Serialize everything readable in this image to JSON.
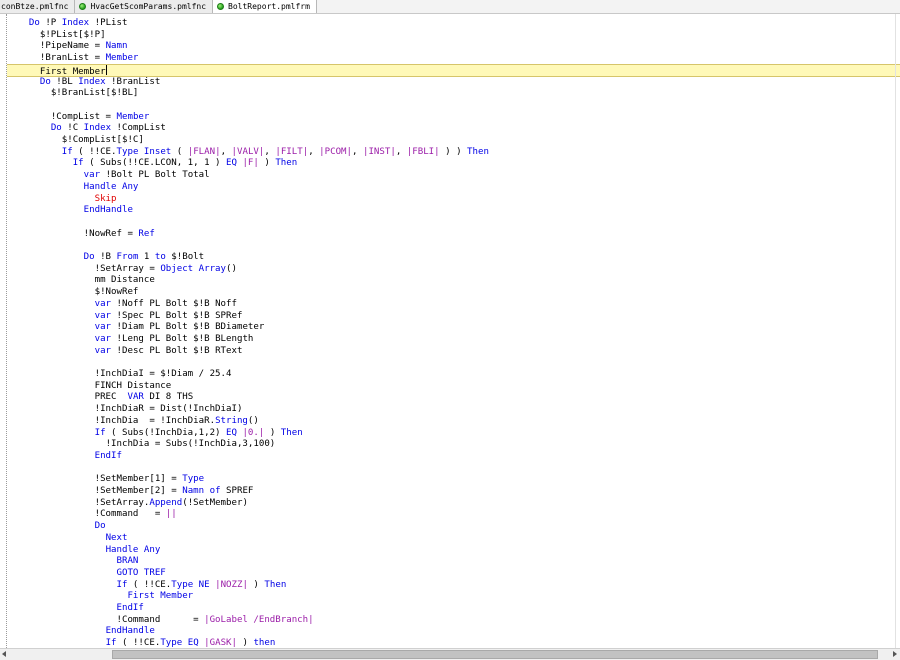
{
  "tabs": [
    {
      "label": "conBtze.pmlfnc",
      "icon": "none",
      "active": false
    },
    {
      "label": "HvacGetScomParams.pmlfnc",
      "icon": "pml-file-icon",
      "active": false
    },
    {
      "label": "BoltReport.pmlfrm",
      "icon": "pml-file-icon",
      "active": true
    }
  ],
  "colors": {
    "keyword": "#0000e6",
    "string": "#9b1da8",
    "red": "#e00000",
    "current_line": "#fff9b8"
  },
  "editor": {
    "current_line_index": 4,
    "lines": [
      {
        "indent": 4,
        "tokens": [
          {
            "t": "Do",
            "k": "kw"
          },
          {
            "t": " !P "
          },
          {
            "t": "Index",
            "k": "kw"
          },
          {
            "t": " !PList"
          }
        ]
      },
      {
        "indent": 6,
        "tokens": [
          {
            "t": "$!PList[$!P]"
          }
        ]
      },
      {
        "indent": 6,
        "tokens": [
          {
            "t": "!PipeName = "
          },
          {
            "t": "Namn",
            "k": "kw"
          }
        ]
      },
      {
        "indent": 6,
        "tokens": [
          {
            "t": "!BranList = "
          },
          {
            "t": "Member",
            "k": "kw"
          }
        ]
      },
      {
        "indent": 6,
        "tokens": [
          {
            "t": "First Member"
          }
        ]
      },
      {
        "indent": 6,
        "tokens": [
          {
            "t": "Do",
            "k": "kw"
          },
          {
            "t": " !BL "
          },
          {
            "t": "Index",
            "k": "kw"
          },
          {
            "t": " !BranList"
          }
        ]
      },
      {
        "indent": 8,
        "tokens": [
          {
            "t": "$!BranList[$!BL]"
          }
        ]
      },
      {
        "indent": 0,
        "tokens": []
      },
      {
        "indent": 8,
        "tokens": [
          {
            "t": "!CompList = "
          },
          {
            "t": "Member",
            "k": "kw"
          }
        ]
      },
      {
        "indent": 8,
        "tokens": [
          {
            "t": "Do",
            "k": "kw"
          },
          {
            "t": " !C "
          },
          {
            "t": "Index",
            "k": "kw"
          },
          {
            "t": " !CompList"
          }
        ]
      },
      {
        "indent": 10,
        "tokens": [
          {
            "t": "$!CompList[$!C]"
          }
        ]
      },
      {
        "indent": 10,
        "tokens": [
          {
            "t": "If",
            "k": "kw"
          },
          {
            "t": " ( !!CE."
          },
          {
            "t": "Type",
            "k": "kw"
          },
          {
            "t": " "
          },
          {
            "t": "Inset",
            "k": "kw"
          },
          {
            "t": " ( "
          },
          {
            "t": "|FLAN|",
            "k": "str"
          },
          {
            "t": ", "
          },
          {
            "t": "|VALV|",
            "k": "str"
          },
          {
            "t": ", "
          },
          {
            "t": "|FILT|",
            "k": "str"
          },
          {
            "t": ", "
          },
          {
            "t": "|PCOM|",
            "k": "str"
          },
          {
            "t": ", "
          },
          {
            "t": "|INST|",
            "k": "str"
          },
          {
            "t": ", "
          },
          {
            "t": "|FBLI|",
            "k": "str"
          },
          {
            "t": " ) ) "
          },
          {
            "t": "Then",
            "k": "kw"
          }
        ]
      },
      {
        "indent": 12,
        "tokens": [
          {
            "t": "If",
            "k": "kw"
          },
          {
            "t": " ( Subs(!!CE.LCON, 1, 1 ) "
          },
          {
            "t": "EQ",
            "k": "kw"
          },
          {
            "t": " "
          },
          {
            "t": "|F|",
            "k": "str"
          },
          {
            "t": " ) "
          },
          {
            "t": "Then",
            "k": "kw"
          }
        ]
      },
      {
        "indent": 14,
        "tokens": [
          {
            "t": "var",
            "k": "kw"
          },
          {
            "t": " !Bolt PL Bolt Total"
          }
        ]
      },
      {
        "indent": 14,
        "tokens": [
          {
            "t": "Handle Any",
            "k": "kw"
          }
        ]
      },
      {
        "indent": 16,
        "tokens": [
          {
            "t": "Skip",
            "k": "red"
          }
        ]
      },
      {
        "indent": 14,
        "tokens": [
          {
            "t": "EndHandle",
            "k": "kw"
          }
        ]
      },
      {
        "indent": 0,
        "tokens": []
      },
      {
        "indent": 14,
        "tokens": [
          {
            "t": "!NowRef = "
          },
          {
            "t": "Ref",
            "k": "kw"
          }
        ]
      },
      {
        "indent": 0,
        "tokens": []
      },
      {
        "indent": 14,
        "tokens": [
          {
            "t": "Do",
            "k": "kw"
          },
          {
            "t": " !B "
          },
          {
            "t": "From",
            "k": "kw"
          },
          {
            "t": " 1 "
          },
          {
            "t": "to",
            "k": "kw"
          },
          {
            "t": " $!Bolt"
          }
        ]
      },
      {
        "indent": 16,
        "tokens": [
          {
            "t": "!SetArray = "
          },
          {
            "t": "Object Array",
            "k": "kw"
          },
          {
            "t": "()"
          }
        ]
      },
      {
        "indent": 16,
        "tokens": [
          {
            "t": "mm Distance"
          }
        ]
      },
      {
        "indent": 16,
        "tokens": [
          {
            "t": "$!NowRef"
          }
        ]
      },
      {
        "indent": 16,
        "tokens": [
          {
            "t": "var",
            "k": "kw"
          },
          {
            "t": " !Noff PL Bolt $!B Noff"
          }
        ]
      },
      {
        "indent": 16,
        "tokens": [
          {
            "t": "var",
            "k": "kw"
          },
          {
            "t": " !Spec PL Bolt $!B SPRef"
          }
        ]
      },
      {
        "indent": 16,
        "tokens": [
          {
            "t": "var",
            "k": "kw"
          },
          {
            "t": " !Diam PL Bolt $!B BDiameter"
          }
        ]
      },
      {
        "indent": 16,
        "tokens": [
          {
            "t": "var",
            "k": "kw"
          },
          {
            "t": " !Leng PL Bolt $!B BLength"
          }
        ]
      },
      {
        "indent": 16,
        "tokens": [
          {
            "t": "var",
            "k": "kw"
          },
          {
            "t": " !Desc PL Bolt $!B RText"
          }
        ]
      },
      {
        "indent": 0,
        "tokens": []
      },
      {
        "indent": 16,
        "tokens": [
          {
            "t": "!InchDiaI = $!Diam / 25.4"
          }
        ]
      },
      {
        "indent": 16,
        "tokens": [
          {
            "t": "FINCH Distance"
          }
        ]
      },
      {
        "indent": 16,
        "tokens": [
          {
            "t": "PREC  "
          },
          {
            "t": "VAR",
            "k": "kw"
          },
          {
            "t": " DI 8 THS"
          }
        ]
      },
      {
        "indent": 16,
        "tokens": [
          {
            "t": "!InchDiaR = Dist(!InchDiaI)"
          }
        ]
      },
      {
        "indent": 16,
        "tokens": [
          {
            "t": "!InchDia  = !InchDiaR."
          },
          {
            "t": "String",
            "k": "kw"
          },
          {
            "t": "()"
          }
        ]
      },
      {
        "indent": 16,
        "tokens": [
          {
            "t": "If",
            "k": "kw"
          },
          {
            "t": " ( Subs(!InchDia,1,2) "
          },
          {
            "t": "EQ",
            "k": "kw"
          },
          {
            "t": " "
          },
          {
            "t": "|0.|",
            "k": "str"
          },
          {
            "t": " ) "
          },
          {
            "t": "Then",
            "k": "kw"
          }
        ]
      },
      {
        "indent": 18,
        "tokens": [
          {
            "t": "!InchDia = Subs(!InchDia,3,100)"
          }
        ]
      },
      {
        "indent": 16,
        "tokens": [
          {
            "t": "EndIf",
            "k": "kw"
          }
        ]
      },
      {
        "indent": 0,
        "tokens": []
      },
      {
        "indent": 16,
        "tokens": [
          {
            "t": "!SetMember[1] = "
          },
          {
            "t": "Type",
            "k": "kw"
          }
        ]
      },
      {
        "indent": 16,
        "tokens": [
          {
            "t": "!SetMember[2] = "
          },
          {
            "t": "Namn of",
            "k": "kw"
          },
          {
            "t": " SPREF"
          }
        ]
      },
      {
        "indent": 16,
        "tokens": [
          {
            "t": "!SetArray."
          },
          {
            "t": "Append",
            "k": "kw"
          },
          {
            "t": "(!SetMember)"
          }
        ]
      },
      {
        "indent": 16,
        "tokens": [
          {
            "t": "!Command   = "
          },
          {
            "t": "||",
            "k": "str"
          }
        ]
      },
      {
        "indent": 16,
        "tokens": [
          {
            "t": "Do",
            "k": "kw"
          }
        ]
      },
      {
        "indent": 18,
        "tokens": [
          {
            "t": "Next",
            "k": "kw"
          }
        ]
      },
      {
        "indent": 18,
        "tokens": [
          {
            "t": "Handle Any",
            "k": "kw"
          }
        ]
      },
      {
        "indent": 20,
        "tokens": [
          {
            "t": "BRAN",
            "k": "kw"
          }
        ]
      },
      {
        "indent": 20,
        "tokens": [
          {
            "t": "GOTO TREF",
            "k": "kw"
          }
        ]
      },
      {
        "indent": 20,
        "tokens": [
          {
            "t": "If",
            "k": "kw"
          },
          {
            "t": " ( !!CE."
          },
          {
            "t": "Type",
            "k": "kw"
          },
          {
            "t": " "
          },
          {
            "t": "NE",
            "k": "kw"
          },
          {
            "t": " "
          },
          {
            "t": "|NOZZ|",
            "k": "str"
          },
          {
            "t": " ) "
          },
          {
            "t": "Then",
            "k": "kw"
          }
        ]
      },
      {
        "indent": 22,
        "tokens": [
          {
            "t": "First Member",
            "k": "kw"
          }
        ]
      },
      {
        "indent": 20,
        "tokens": [
          {
            "t": "EndIf",
            "k": "kw"
          }
        ]
      },
      {
        "indent": 20,
        "tokens": [
          {
            "t": "!Command      = "
          },
          {
            "t": "|GoLabel /EndBranch|",
            "k": "str"
          }
        ]
      },
      {
        "indent": 18,
        "tokens": [
          {
            "t": "EndHandle",
            "k": "kw"
          }
        ]
      },
      {
        "indent": 18,
        "tokens": [
          {
            "t": "If",
            "k": "kw"
          },
          {
            "t": " ( !!CE."
          },
          {
            "t": "Type",
            "k": "kw"
          },
          {
            "t": " "
          },
          {
            "t": "EQ",
            "k": "kw"
          },
          {
            "t": " "
          },
          {
            "t": "|GASK|",
            "k": "str"
          },
          {
            "t": " ) "
          },
          {
            "t": "then",
            "k": "kw"
          }
        ]
      }
    ]
  }
}
